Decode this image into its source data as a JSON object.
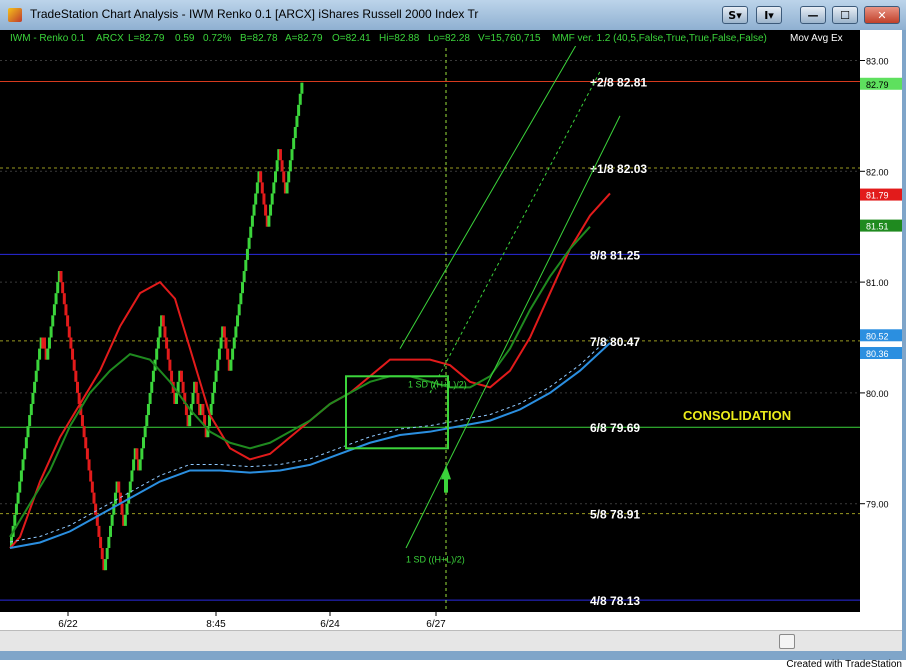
{
  "window": {
    "title": "TradeStation Chart Analysis - IWM Renko 0.1 [ARCX] iShares Russell 2000 Index Tr",
    "buttons": {
      "s": "S",
      "i": "I",
      "min": "—",
      "max": "☐",
      "close": "✕"
    }
  },
  "info_bar": {
    "symbol": "IWM - Renko 0.1",
    "exchange": "ARCX",
    "last": "L=82.79",
    "change": "0.59",
    "pct": "0.72%",
    "bid": "B=82.78",
    "ask": "A=82.79",
    "open": "O=82.41",
    "high": "Hi=82.88",
    "low": "Lo=82.28",
    "volume": "V=15,760,715",
    "indicator": "MMF ver. 1.2 (40,5,False,True,True,False,False)",
    "mov_avg": "Mov Avg Ex"
  },
  "chart_data": {
    "type": "line",
    "x_ticks": [
      "6/22",
      "8:45",
      "6/24",
      "6/27"
    ],
    "y_ticks": [
      "83.00",
      "82.00",
      "81.00",
      "80.00",
      "79.00"
    ],
    "ylim": [
      78.0,
      83.2
    ],
    "murrey_levels": [
      {
        "label": "+2/8",
        "value": "82.81",
        "color": "#d63a1e"
      },
      {
        "label": "+1/8",
        "value": "82.03",
        "color": "#9a9a20"
      },
      {
        "label": "8/8",
        "value": "81.25",
        "color": "#2a2adf"
      },
      {
        "label": "7/8",
        "value": "80.47",
        "color": "#9a9a20"
      },
      {
        "label": "6/8",
        "value": "79.69",
        "color": "#3bd43b"
      },
      {
        "label": "5/8",
        "value": "78.91",
        "color": "#9a9a20"
      },
      {
        "label": "4/8",
        "value": "78.13",
        "color": "#2a2adf"
      }
    ],
    "price_tags": [
      {
        "value": "82.79",
        "bg": "#5ee05e",
        "fg": "#000000"
      },
      {
        "value": "81.79",
        "bg": "#e21b1b",
        "fg": "#ffffff"
      },
      {
        "value": "81.51",
        "bg": "#1f8a1f",
        "fg": "#ffffff"
      },
      {
        "value": "80.52",
        "bg": "#2b8fe0",
        "fg": "#ffffff"
      },
      {
        "value": "80.36",
        "bg": "#2b8fe0",
        "fg": "#ffffff"
      }
    ],
    "annotations": {
      "consolidation": "CONSOLIDATION",
      "sd_upper": "1 SD ((H+L)/2)",
      "sd_lower": "1 SD ((H+L)/2)"
    },
    "series": [
      {
        "name": "red",
        "color": "#e21b1b",
        "values": [
          [
            0,
            78.6
          ],
          [
            10,
            78.7
          ],
          [
            30,
            79.2
          ],
          [
            50,
            79.6
          ],
          [
            70,
            79.9
          ],
          [
            90,
            80.2
          ],
          [
            110,
            80.6
          ],
          [
            130,
            80.9
          ],
          [
            150,
            81.0
          ],
          [
            165,
            80.85
          ],
          [
            180,
            80.4
          ],
          [
            200,
            79.8
          ],
          [
            220,
            79.5
          ],
          [
            240,
            79.4
          ],
          [
            260,
            79.45
          ],
          [
            280,
            79.6
          ],
          [
            300,
            79.75
          ],
          [
            320,
            79.9
          ],
          [
            340,
            80.0
          ],
          [
            360,
            80.15
          ],
          [
            380,
            80.3
          ],
          [
            400,
            80.3
          ],
          [
            420,
            80.3
          ],
          [
            440,
            80.25
          ],
          [
            460,
            80.1
          ],
          [
            480,
            80.05
          ],
          [
            500,
            80.2
          ],
          [
            520,
            80.5
          ],
          [
            540,
            80.9
          ],
          [
            560,
            81.3
          ],
          [
            580,
            81.6
          ],
          [
            600,
            81.8
          ]
        ]
      },
      {
        "name": "green",
        "color": "#1f8a1f",
        "values": [
          [
            0,
            78.7
          ],
          [
            20,
            79.0
          ],
          [
            40,
            79.3
          ],
          [
            60,
            79.7
          ],
          [
            80,
            80.0
          ],
          [
            100,
            80.2
          ],
          [
            120,
            80.35
          ],
          [
            140,
            80.3
          ],
          [
            160,
            80.1
          ],
          [
            180,
            79.85
          ],
          [
            200,
            79.65
          ],
          [
            220,
            79.55
          ],
          [
            240,
            79.5
          ],
          [
            260,
            79.55
          ],
          [
            280,
            79.65
          ],
          [
            300,
            79.75
          ],
          [
            320,
            79.9
          ],
          [
            340,
            80.0
          ],
          [
            360,
            80.1
          ],
          [
            380,
            80.15
          ],
          [
            400,
            80.15
          ],
          [
            420,
            80.1
          ],
          [
            440,
            80.05
          ],
          [
            460,
            80.05
          ],
          [
            480,
            80.15
          ],
          [
            500,
            80.4
          ],
          [
            520,
            80.75
          ],
          [
            540,
            81.05
          ],
          [
            560,
            81.3
          ],
          [
            580,
            81.5
          ]
        ]
      },
      {
        "name": "blue",
        "color": "#2b8fe0",
        "values": [
          [
            0,
            78.6
          ],
          [
            30,
            78.65
          ],
          [
            60,
            78.75
          ],
          [
            90,
            78.9
          ],
          [
            120,
            79.05
          ],
          [
            150,
            79.2
          ],
          [
            180,
            79.3
          ],
          [
            210,
            79.3
          ],
          [
            240,
            79.28
          ],
          [
            270,
            79.3
          ],
          [
            300,
            79.35
          ],
          [
            330,
            79.45
          ],
          [
            360,
            79.55
          ],
          [
            390,
            79.62
          ],
          [
            420,
            79.65
          ],
          [
            450,
            79.7
          ],
          [
            480,
            79.75
          ],
          [
            510,
            79.85
          ],
          [
            540,
            80.0
          ],
          [
            570,
            80.2
          ],
          [
            600,
            80.45
          ]
        ]
      }
    ]
  },
  "footer": "Created with TradeStation"
}
